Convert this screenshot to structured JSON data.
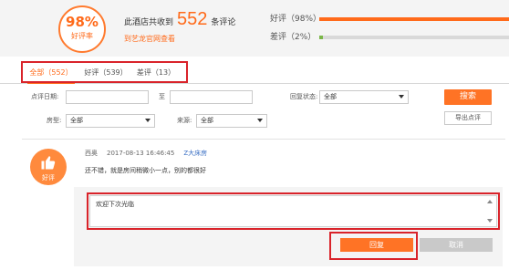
{
  "summary": {
    "rate_value": "98%",
    "rate_label": "好评率",
    "total_prefix": "此酒店共收到",
    "total_count": "552",
    "total_suffix": "条评论",
    "link_label": "到艺龙官网查看",
    "positive": {
      "label": "好评（98%）",
      "fraction": 0.98
    },
    "negative": {
      "label": "差评（2%）",
      "fraction": 0.02
    }
  },
  "tabs": [
    {
      "label": "全部（552）",
      "active": true
    },
    {
      "label": "好评（539）",
      "active": false
    },
    {
      "label": "差评（13）",
      "active": false
    }
  ],
  "filters": {
    "date_label": "点评日期:",
    "date_from": "",
    "date_to_label": "至",
    "date_to": "",
    "reply_status_label": "回复状态:",
    "reply_status_value": "全部",
    "room_type_label": "房型:",
    "room_type_value": "全部",
    "source_label": "来源:",
    "source_value": "全部",
    "search_button": "搜索",
    "export_button": "导出点评"
  },
  "review": {
    "avatar_label": "好评",
    "reviewer": "西奥",
    "datetime": "2017-08-13 16:46:45",
    "room_type": "Z大床房",
    "content": "还不错，就是房间稍微小一点，别的都很好"
  },
  "reply": {
    "text": "欢迎下次光临",
    "reply_button": "回复",
    "cancel_button": "取消"
  },
  "colors": {
    "accent": "#ff6a1a",
    "bar_positive": "#ff6a1a",
    "bar_negative": "#7ab648",
    "highlight_box": "#d9232a"
  }
}
